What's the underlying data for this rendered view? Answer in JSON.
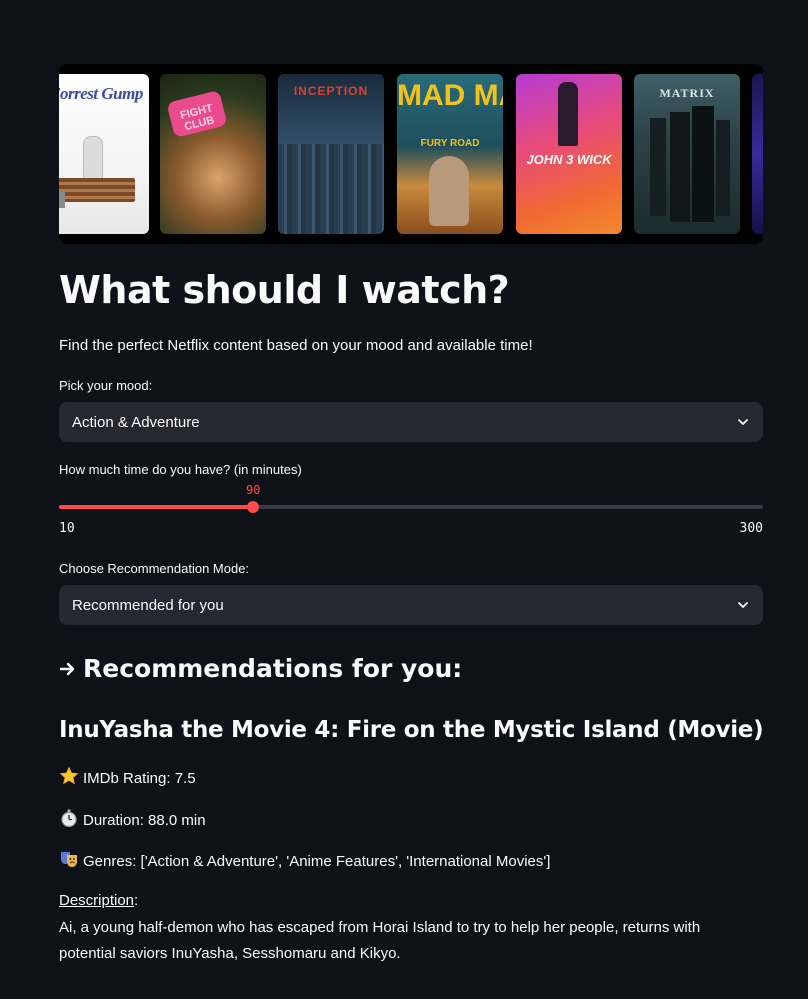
{
  "posters": [
    {
      "title": "Forrest Gump"
    },
    {
      "title": "FIGHT CLUB"
    },
    {
      "title": "INCEPTION"
    },
    {
      "title": "MAD MAX",
      "subtitle": "FURY ROAD"
    },
    {
      "title": "JOHN 3 WICK"
    },
    {
      "title": "MATRIX"
    }
  ],
  "page": {
    "title": "What should I watch?",
    "intro": "Find the perfect Netflix content based on your mood and available time!"
  },
  "mood": {
    "label": "Pick your mood:",
    "selected": "Action & Adventure"
  },
  "time": {
    "label": "How much time do you have? (in minutes)",
    "value": "90",
    "min": "10",
    "max": "300",
    "fraction": 0.2759
  },
  "mode": {
    "label": "Choose Recommendation Mode:",
    "selected": "Recommended for you"
  },
  "recommendations": {
    "heading": "Recommendations for you:",
    "movie_title": "InuYasha the Movie 4: Fire on the Mystic Island (Movie)",
    "rating": "IMDb Rating: 7.5",
    "duration": "Duration: 88.0 min",
    "genres": "Genres: ['Action & Adventure', 'Anime Features', 'International Movies']",
    "description_label": "Description",
    "description_colon": ":",
    "description": "Ai, a young half-demon who has escaped from Horai Island to try to help her people, returns with potential saviors InuYasha, Sesshomaru and Kikyo."
  },
  "colors": {
    "background": "#0e1117",
    "input_bg": "#262730",
    "accent": "#ff4b4b"
  },
  "icons": [
    "arrow-right-icon",
    "star-icon",
    "stopwatch-icon",
    "performing-arts-icon",
    "chevron-down-icon"
  ]
}
